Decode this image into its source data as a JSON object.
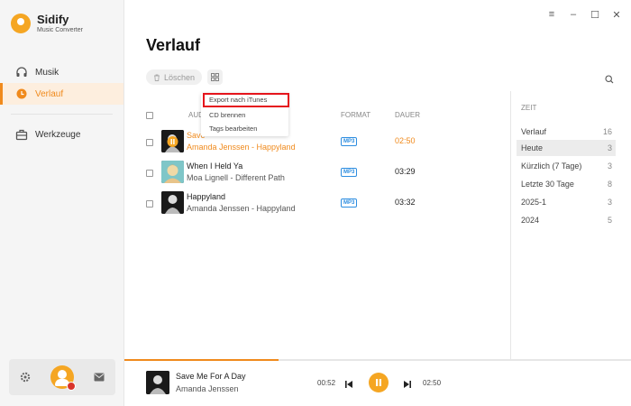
{
  "app": {
    "name": "Sidify",
    "subtitle": "Music Converter"
  },
  "sidebar": {
    "items": [
      {
        "label": "Musik",
        "icon": "headphones-icon",
        "active": false
      },
      {
        "label": "Verlauf",
        "icon": "clock-icon",
        "active": true
      },
      {
        "label": "Werkzeuge",
        "icon": "toolbox-icon",
        "active": false
      }
    ]
  },
  "page": {
    "title": "Verlauf"
  },
  "toolbar": {
    "delete_label": "Löschen"
  },
  "menu": {
    "items": [
      "Export nach iTunes",
      "CD brennen",
      "Tags bearbeiten"
    ]
  },
  "table": {
    "headers": {
      "audio": "AUD",
      "format": "FORMAT",
      "duration": "DAUER"
    },
    "rows": [
      {
        "title": "Save",
        "subtitle": "Amanda Jenssen - Happyland",
        "format": "MP3",
        "duration": "02:50",
        "playing": true
      },
      {
        "title": "When I Held Ya",
        "subtitle": "Moa Lignell - Different Path",
        "format": "MP3",
        "duration": "03:29",
        "playing": false
      },
      {
        "title": "Happyland",
        "subtitle": "Amanda Jenssen - Happyland",
        "format": "MP3",
        "duration": "03:32",
        "playing": false
      }
    ]
  },
  "timePanel": {
    "title": "ZEIT",
    "items": [
      {
        "label": "Verlauf",
        "count": "16"
      },
      {
        "label": "Heute",
        "count": "3",
        "selected": true
      },
      {
        "label": "Kürzlich (7 Tage)",
        "count": "3"
      },
      {
        "label": "Letzte 30 Tage",
        "count": "8"
      },
      {
        "label": "2025-1",
        "count": "3"
      },
      {
        "label": "2024",
        "count": "5"
      }
    ]
  },
  "player": {
    "title": "Save Me For A Day",
    "artist": "Amanda Jenssen",
    "current": "00:52",
    "total": "02:50",
    "progress": 0.305
  },
  "colors": {
    "accent": "#f08a1c",
    "highlight_box": "#e5141c",
    "format_badge": "#2d8de0"
  }
}
